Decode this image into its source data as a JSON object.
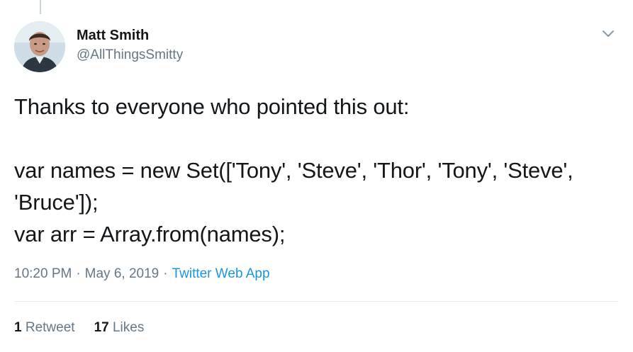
{
  "tweet": {
    "author_name": "Matt Smith",
    "author_handle": "@AllThingsSmitty",
    "text": "Thanks to everyone who pointed this out:\n\nvar names = new Set(['Tony', 'Steve', 'Thor', 'Tony', 'Steve',\n'Bruce']);\nvar arr = Array.from(names);",
    "time": "10:20 PM",
    "date": "May 6, 2019",
    "separator": "·",
    "source": "Twitter Web App",
    "retweets": {
      "count": "1",
      "label": "Retweet"
    },
    "likes": {
      "count": "17",
      "label": "Likes"
    }
  },
  "icons": {
    "more": "chevron-down-icon",
    "avatar": "avatar"
  },
  "colors": {
    "text_primary": "#14171a",
    "text_secondary": "#657786",
    "link": "#1b95e0",
    "divider": "#e6ecf0",
    "thread_line": "#ccd6dd"
  }
}
